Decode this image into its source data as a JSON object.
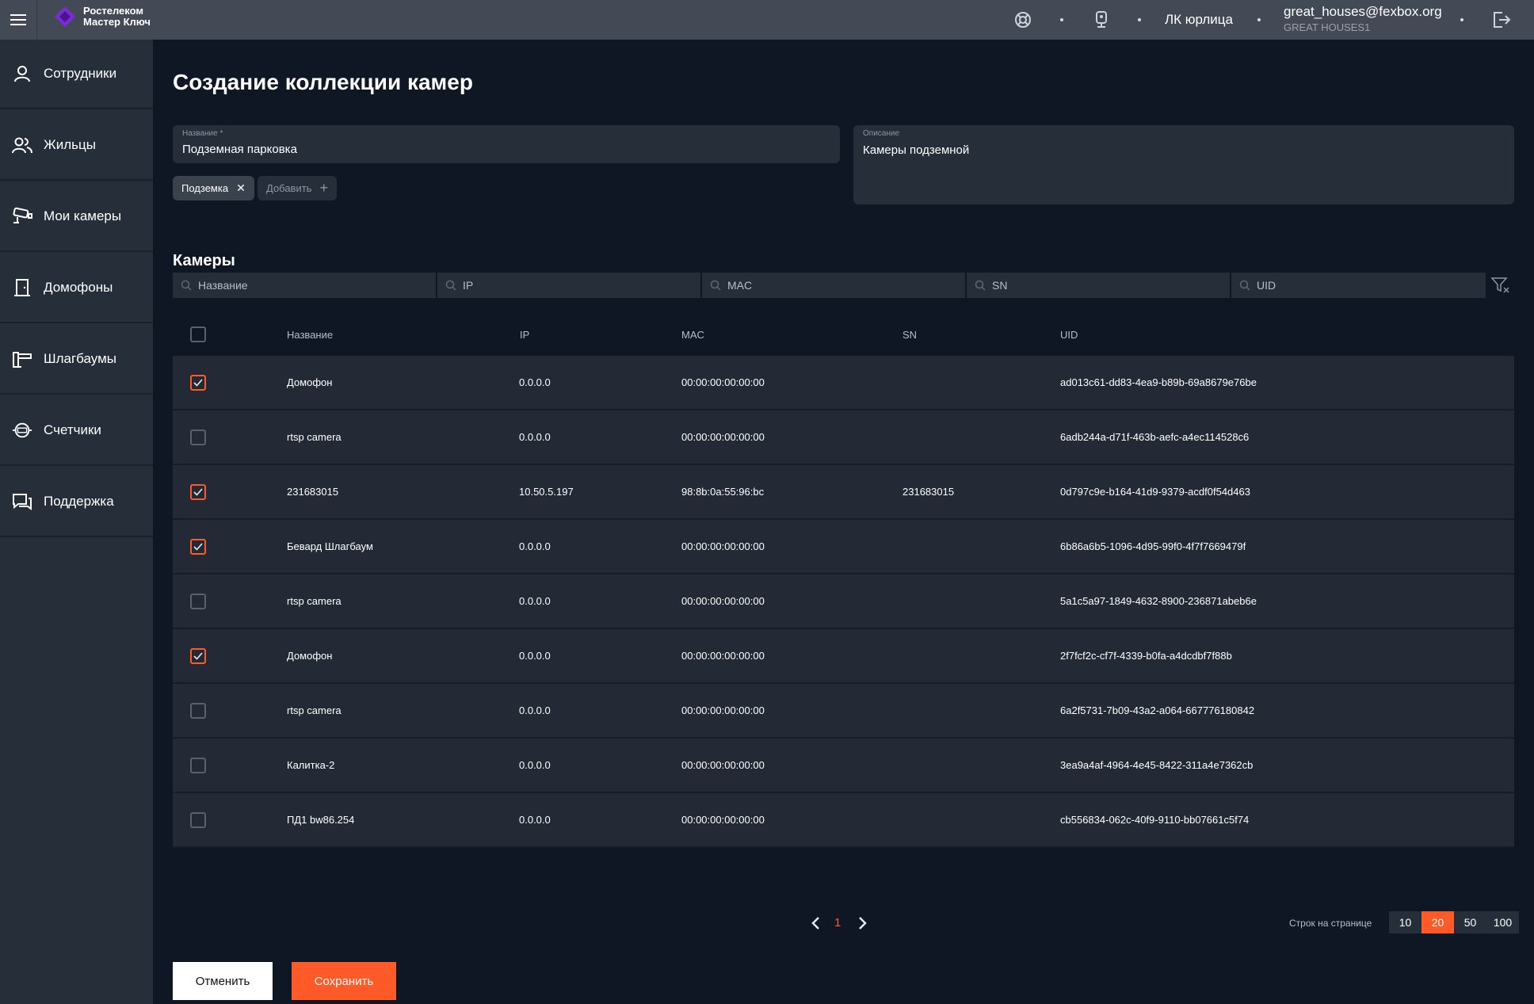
{
  "app": {
    "logo_line1": "Ростелеком",
    "logo_line2": "Мастер Ключ",
    "account_type": "ЛК юрлица",
    "user_email": "great_houses@fexbox.org",
    "user_org": "GREAT HOUSES1"
  },
  "sidebar": {
    "items": [
      {
        "label": "Сотрудники",
        "icon": "person-icon"
      },
      {
        "label": "Жильцы",
        "icon": "people-icon"
      },
      {
        "label": "Мои камеры",
        "icon": "camera-icon"
      },
      {
        "label": "Домофоны",
        "icon": "door-icon"
      },
      {
        "label": "Шлагбаумы",
        "icon": "barrier-icon"
      },
      {
        "label": "Счетчики",
        "icon": "meter-icon"
      },
      {
        "label": "Поддержка",
        "icon": "chat-icon"
      }
    ]
  },
  "page": {
    "title": "Создание коллекции камер",
    "name_label": "Название *",
    "name_value": "Подземная парковка",
    "desc_label": "Описание",
    "desc_value": "Камеры подземной",
    "tag_chip": "Подземка",
    "tag_add": "Добавить",
    "section_title": "Камеры"
  },
  "filters": {
    "name": "Название",
    "ip": "IP",
    "mac": "MAC",
    "sn": "SN",
    "uid": "UID"
  },
  "table": {
    "headers": {
      "name": "Название",
      "ip": "IP",
      "mac": "MAC",
      "sn": "SN",
      "uid": "UID"
    },
    "rows": [
      {
        "checked": true,
        "name": "Домофон",
        "ip": "0.0.0.0",
        "mac": "00:00:00:00:00:00",
        "sn": "",
        "uid": "ad013c61-dd83-4ea9-b89b-69a8679e76be"
      },
      {
        "checked": false,
        "name": "rtsp camera",
        "ip": "0.0.0.0",
        "mac": "00:00:00:00:00:00",
        "sn": "",
        "uid": "6adb244a-d71f-463b-aefc-a4ec114528c6"
      },
      {
        "checked": true,
        "name": "231683015",
        "ip": "10.50.5.197",
        "mac": "98:8b:0a:55:96:bc",
        "sn": "231683015",
        "uid": "0d797c9e-b164-41d9-9379-acdf0f54d463"
      },
      {
        "checked": true,
        "name": "Бевард Шлагбаум",
        "ip": "0.0.0.0",
        "mac": "00:00:00:00:00:00",
        "sn": "",
        "uid": "6b86a6b5-1096-4d95-99f0-4f7f7669479f"
      },
      {
        "checked": false,
        "name": "rtsp camera",
        "ip": "0.0.0.0",
        "mac": "00:00:00:00:00:00",
        "sn": "",
        "uid": "5a1c5a97-1849-4632-8900-236871abeb6e"
      },
      {
        "checked": true,
        "name": "Домофон",
        "ip": "0.0.0.0",
        "mac": "00:00:00:00:00:00",
        "sn": "",
        "uid": "2f7fcf2c-cf7f-4339-b0fa-a4dcdbf7f88b"
      },
      {
        "checked": false,
        "name": "rtsp camera",
        "ip": "0.0.0.0",
        "mac": "00:00:00:00:00:00",
        "sn": "",
        "uid": "6a2f5731-7b09-43a2-a064-667776180842"
      },
      {
        "checked": false,
        "name": "Калитка-2",
        "ip": "0.0.0.0",
        "mac": "00:00:00:00:00:00",
        "sn": "",
        "uid": "3ea9a4af-4964-4e45-8422-311a4e7362cb"
      },
      {
        "checked": false,
        "name": "ПД1 bw86.254",
        "ip": "0.0.0.0",
        "mac": "00:00:00:00:00:00",
        "sn": "",
        "uid": "cb556834-062c-40f9-9110-bb07661c5f74"
      }
    ]
  },
  "pagination": {
    "current_page": "1",
    "rows_label": "Строк на странице",
    "rows_options": [
      "10",
      "20",
      "50",
      "100"
    ],
    "rows_selected": "20"
  },
  "actions": {
    "cancel": "Отменить",
    "save": "Сохранить"
  },
  "colors": {
    "accent": "#ff5a28",
    "topbar": "#434a55",
    "sidebar": "#262e3a",
    "background": "#0f1724"
  }
}
